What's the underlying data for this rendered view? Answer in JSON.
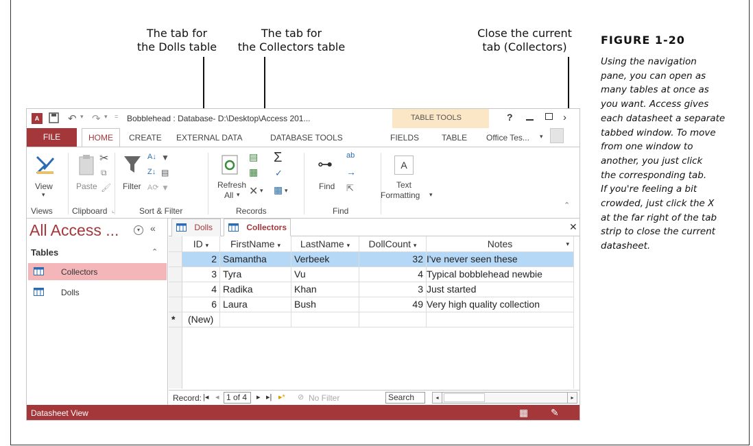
{
  "callouts": {
    "dolls_tab": [
      "The tab for",
      "the Dolls table"
    ],
    "collectors_tab": [
      "The tab for",
      "the Collectors table"
    ],
    "close_tab": [
      "Close the current",
      "tab (Collectors)"
    ]
  },
  "figure": {
    "title": "FIGURE 1-20",
    "caption_lines": [
      "Using the navigation",
      "pane, you can open as",
      "many tables at once as",
      "you want. Access gives",
      "each datasheet a separate",
      "tabbed window. To move",
      "from one window to",
      "another, you just click",
      "the corresponding tab.",
      "If you're feeling a bit",
      "crowded, just click the X",
      "at the far right of the tab",
      "strip to close the current",
      "datasheet."
    ]
  },
  "window": {
    "title": "Bobblehead : Database- D:\\Desktop\\Access 201...",
    "contextual_tab_group": "TABLE TOOLS",
    "help": "?",
    "user": "Office Tes...",
    "accent_color": "#a4373a"
  },
  "ribbon_tabs": {
    "file": "FILE",
    "home": "HOME",
    "create": "CREATE",
    "external_data": "EXTERNAL DATA",
    "database_tools": "DATABASE TOOLS",
    "fields": "FIELDS",
    "table": "TABLE"
  },
  "ribbon": {
    "view": "View",
    "paste": "Paste",
    "filter": "Filter",
    "refresh_lines": [
      "Refresh",
      "All"
    ],
    "find": "Find",
    "text_formatting_lines": [
      "Text",
      "Formatting"
    ],
    "groups": {
      "views": "Views",
      "clipboard": "Clipboard",
      "sort_filter": "Sort & Filter",
      "records": "Records",
      "find": "Find"
    }
  },
  "nav_pane": {
    "title": "All Access ...",
    "section": "Tables",
    "items": [
      "Collectors",
      "Dolls"
    ]
  },
  "doc_tabs": [
    "Dolls",
    "Collectors"
  ],
  "datasheet": {
    "columns": [
      "ID",
      "FirstName",
      "LastName",
      "DollCount",
      "Notes"
    ],
    "rows": [
      {
        "id": "2",
        "first": "Samantha",
        "last": "Verbeek",
        "count": "32",
        "notes": "I've never seen these"
      },
      {
        "id": "3",
        "first": "Tyra",
        "last": "Vu",
        "count": "4",
        "notes": "Typical bobblehead newbie"
      },
      {
        "id": "4",
        "first": "Radika",
        "last": "Khan",
        "count": "3",
        "notes": "Just started"
      },
      {
        "id": "6",
        "first": "Laura",
        "last": "Bush",
        "count": "49",
        "notes": "Very high quality collection"
      }
    ],
    "new_row": "(New)",
    "new_row_marker": "*"
  },
  "record_nav": {
    "label": "Record:",
    "position": "1 of 4",
    "filter": "No Filter",
    "search": "Search"
  },
  "status_bar": {
    "text": "Datasheet View"
  }
}
